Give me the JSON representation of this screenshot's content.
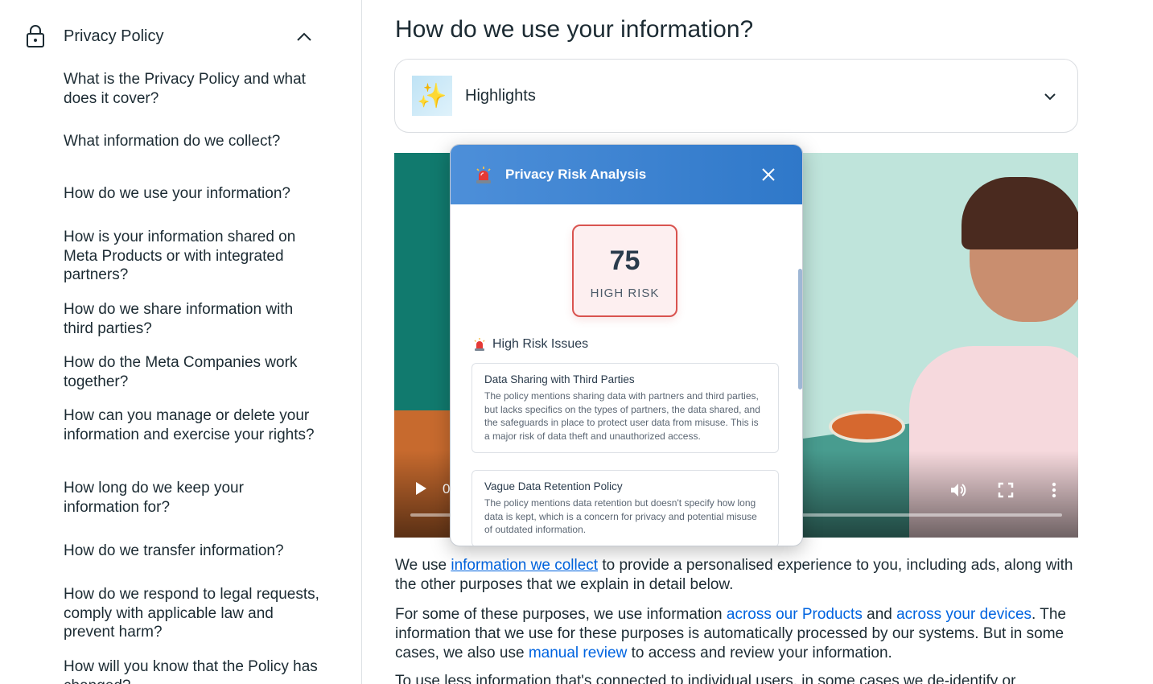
{
  "sidebar": {
    "header": {
      "title": "Privacy Policy",
      "icon": "lock-icon",
      "toggle_icon": "chevron-up-icon"
    },
    "items": [
      "What is the Privacy Policy and what does it cover?",
      "What information do we collect?",
      "How do we use your information?",
      "How is your information shared on Meta Products or with integrated partners?",
      "How do we share information with third parties?",
      "How do the Meta Companies work together?",
      "How can you manage or delete your information and exercise your rights?",
      "How long do we keep your information for?",
      "How do we transfer information?",
      "How do we respond to legal requests, comply with applicable law and prevent harm?",
      "How will you know that the Policy has changed?"
    ]
  },
  "main": {
    "title": "How do we use your information?",
    "highlights": {
      "label": "Highlights",
      "icon": "sparkles-icon",
      "toggle_icon": "chevron-down-icon"
    },
    "video": {
      "time": "0",
      "icons": [
        "play-icon",
        "volume-icon",
        "fullscreen-icon",
        "more-vert-icon"
      ]
    },
    "paragraphs": {
      "p1_a": "We use ",
      "p1_link": "information we collect",
      "p1_b": " to provide a personalised experience to you, including ads, along with the other purposes that we explain in detail below.",
      "p2_a": "For some of these purposes, we use information ",
      "p2_link1": "across our Products",
      "p2_b": " and ",
      "p2_link2": "across your devices",
      "p2_c": ". The information that we use for these purposes is automatically processed by our systems. But in some cases, we also use ",
      "p2_link3": "manual review",
      "p2_d": " to access and review your information.",
      "p3": "To use less information that's connected to individual users, in some cases we de-identify or"
    }
  },
  "popup": {
    "title": "Privacy Risk Analysis",
    "score": "75",
    "score_label": "HIGH RISK",
    "issues_title": "High Risk Issues",
    "colors": {
      "header": "#2f78c9",
      "risk": "#d9534f"
    },
    "issues": [
      {
        "title": "Data Sharing with Third Parties",
        "description": "The policy mentions sharing data with partners and third parties, but lacks specifics on the types of partners, the data shared, and the safeguards in place to protect user data from misuse. This is a major risk of data theft and unauthorized access."
      },
      {
        "title": "Vague Data Retention Policy",
        "description": "The policy mentions data retention but doesn't specify how long data is kept, which is a concern for privacy and potential misuse of outdated information."
      }
    ]
  }
}
